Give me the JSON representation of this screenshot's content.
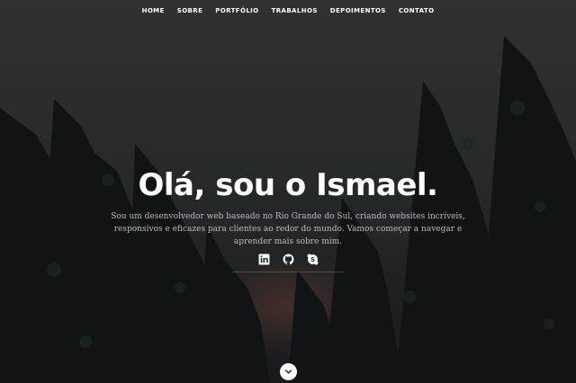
{
  "nav": {
    "items": [
      {
        "label": "HOME"
      },
      {
        "label": "SOBRE"
      },
      {
        "label": "PORTFÓLIO"
      },
      {
        "label": "TRABALHOS"
      },
      {
        "label": "DEPOIMENTOS"
      },
      {
        "label": "CONTATO"
      }
    ]
  },
  "hero": {
    "title": "Olá, sou o Ismael.",
    "intro": "Sou um desenvolvedor web baseado no Rio Grande do Sul, criando websites incríveis, responsivos e eficazes para clientes ao redor do mundo. Vamos começar a navegar e aprender mais sobre mim."
  },
  "social": {
    "icons": [
      "linkedin-icon",
      "github-icon",
      "skype-icon"
    ]
  },
  "scroll": {
    "icon": "chevron-down-icon"
  },
  "colors": {
    "text": "#ffffff",
    "intro_text": "#b9bcbe",
    "background": "#2b2e30"
  }
}
